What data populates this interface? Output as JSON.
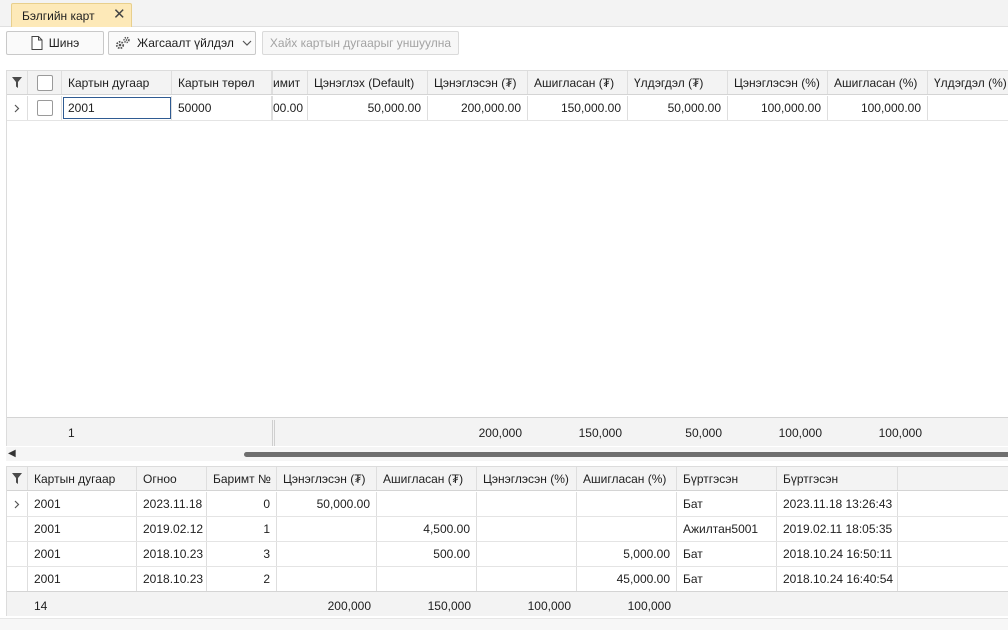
{
  "tab": {
    "title": "Бэлгийн карт",
    "close": "✕"
  },
  "toolbar": {
    "new_label": "Шинэ",
    "settings_label": "Жагсаалт үйлдэл",
    "scan_label": "Хайх картын дугаарыг уншуулна"
  },
  "grid1": {
    "headers": [
      "Картын дугаар",
      "Картын төрөл",
      "имит",
      "Цэнэглэх (Default)",
      "Цэнэглэсэн (₮)",
      "Ашигласан (₮)",
      "Үлдэгдэл (₮)",
      "Цэнэглэсэн (%)",
      "Ашигласан (%)",
      "Үлдэгдэл (%)"
    ],
    "row": [
      "2001",
      "50000",
      "00.00",
      "50,000.00",
      "200,000.00",
      "150,000.00",
      "50,000.00",
      "100,000.00",
      "100,000.00",
      ""
    ],
    "footer": {
      "count": "1",
      "charged": "200,000",
      "used": "150,000",
      "balance": "50,000",
      "charged_pct": "100,000",
      "used_pct": "100,000"
    }
  },
  "grid2": {
    "headers": [
      "Картын дугаар",
      "Огноо",
      "Баримт №",
      "Цэнэглэсэн (₮)",
      "Ашигласан (₮)",
      "Цэнэглэсэн (%)",
      "Ашигласан (%)",
      "Бүртгэсэн",
      "Бүртгэсэн"
    ],
    "rows": [
      [
        "2001",
        "2023.11.18",
        "0",
        "50,000.00",
        "",
        "",
        "",
        "Бат",
        "2023.11.18 13:26:43"
      ],
      [
        "2001",
        "2019.02.12",
        "1",
        "",
        "4,500.00",
        "",
        "",
        "Ажилтан5001",
        "2019.02.11 18:05:35"
      ],
      [
        "2001",
        "2018.10.23",
        "3",
        "",
        "500.00",
        "",
        "5,000.00",
        "Бат",
        "2018.10.24 16:50:11"
      ],
      [
        "2001",
        "2018.10.23",
        "2",
        "",
        "",
        "",
        "45,000.00",
        "Бат",
        "2018.10.24 16:40:54"
      ]
    ],
    "footer": {
      "count": "14",
      "charged": "200,000",
      "used": "150,000",
      "charged_pct": "100,000",
      "used_pct": "100,000"
    }
  },
  "icons": {
    "filter": "filter-icon",
    "expand": "chevron-right-icon",
    "new": "document-icon",
    "settings": "gears-icon",
    "dropdown": "chevron-down-icon",
    "scroll_left": "arrow-left-icon"
  },
  "colors": {
    "tab_active": "#fde9b8",
    "focus": "#2f5b92",
    "header_bg": "#f3f3f3"
  }
}
